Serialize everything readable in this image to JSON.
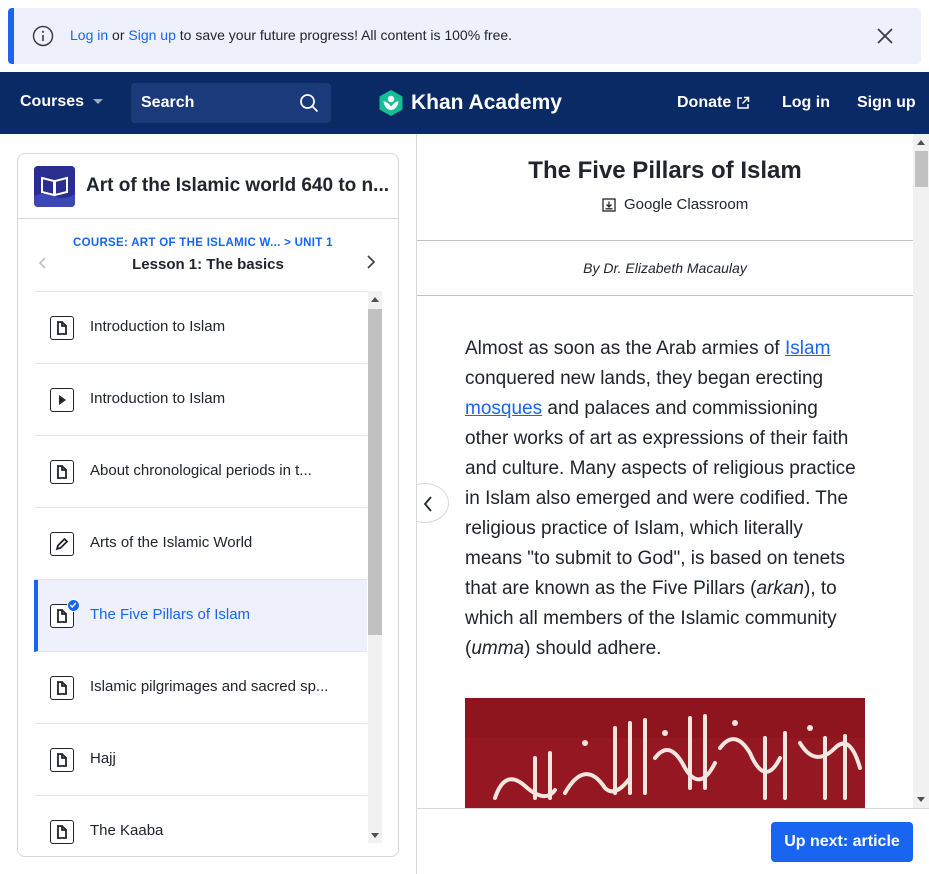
{
  "banner": {
    "login": "Log in",
    "or": "or",
    "signup": "Sign up",
    "message": "to save your future progress! All content is 100% free."
  },
  "nav": {
    "courses": "Courses",
    "search_placeholder": "Search",
    "logo": "Khan Academy",
    "donate": "Donate",
    "login": "Log in",
    "signup": "Sign up",
    "colors": {
      "background": "#0a2a66",
      "accent": "#1865f2",
      "logo_green": "#14bf96"
    }
  },
  "sidebar": {
    "course_title": "Art of the Islamic world 640 to n...",
    "course_link": "COURSE: ART OF THE ISLAMIC W...",
    "unit_link": "> UNIT 1",
    "lesson_title": "Lesson 1: The basics",
    "items": [
      {
        "label": "Introduction to Islam",
        "icon": "article-icon"
      },
      {
        "label": "Introduction to Islam",
        "icon": "video-icon"
      },
      {
        "label": "About chronological periods in t...",
        "icon": "article-icon"
      },
      {
        "label": "Arts of the Islamic World",
        "icon": "exercise-icon"
      },
      {
        "label": "The Five Pillars of Islam",
        "icon": "article-icon",
        "active": true,
        "completed": true
      },
      {
        "label": "Islamic pilgrimages and sacred sp...",
        "icon": "article-icon"
      },
      {
        "label": "Hajj",
        "icon": "article-icon"
      },
      {
        "label": "The Kaaba",
        "icon": "article-icon"
      }
    ]
  },
  "article": {
    "title": "The Five Pillars of Islam",
    "classroom": "Google Classroom",
    "author": "By Dr. Elizabeth Macaulay",
    "body": {
      "p1": "Almost as soon as the Arab armies of ",
      "link1": "Islam",
      "p2": " conquered new lands, they began erecting ",
      "link2": "mosques",
      "p3": " and palaces and commissioning other works of art as expressions of their faith and culture. Many aspects of religious practice in Islam also emerged and were codified. The religious practice of Islam, which literally means \"to submit to God\", is based on tenets that are known as the Five Pillars (",
      "em1": "arkan",
      "p4": "), to which all members of the Islamic community (",
      "em2": "umma",
      "p5": ") should adhere."
    },
    "up_next": "Up next: article"
  }
}
